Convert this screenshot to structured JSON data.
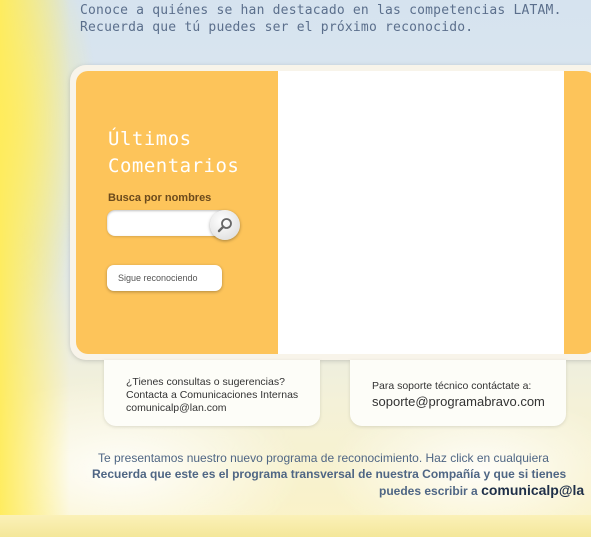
{
  "intro": {
    "line1": "Conoce a quiénes se han destacado en las competencias LATAM.",
    "line2": "Recuerda que tú puedes ser el próximo reconocido."
  },
  "panel": {
    "title_line1": "Últimos",
    "title_line2": "Comentarios",
    "search_label": "Busca por nombres",
    "search_placeholder": "",
    "search_icon": "magnifier-icon",
    "sigue_button": "Sigue reconociendo"
  },
  "info_left": {
    "line1": "¿Tienes consultas o sugerencias?",
    "line2": "Contacta a Comunicaciones Internas",
    "line3": "comunicalp@lan.com"
  },
  "info_right": {
    "line1": "Para soporte técnico contáctate a:",
    "line2": "soporte@programabravo.com"
  },
  "footer": {
    "line1": "Te presentamos nuestro nuevo programa de reconocimiento. Haz click en cualquiera",
    "line2": "Recuerda que este es el programa transversal de nuestra Compañía y que si tienes",
    "line3_prefix": "puedes escribir a",
    "line3_email": "comunicalp@la"
  },
  "colors": {
    "panel_orange": "#fdc45a",
    "text_blue": "#5b6f8c",
    "background_sky": "#d6e3ef"
  }
}
